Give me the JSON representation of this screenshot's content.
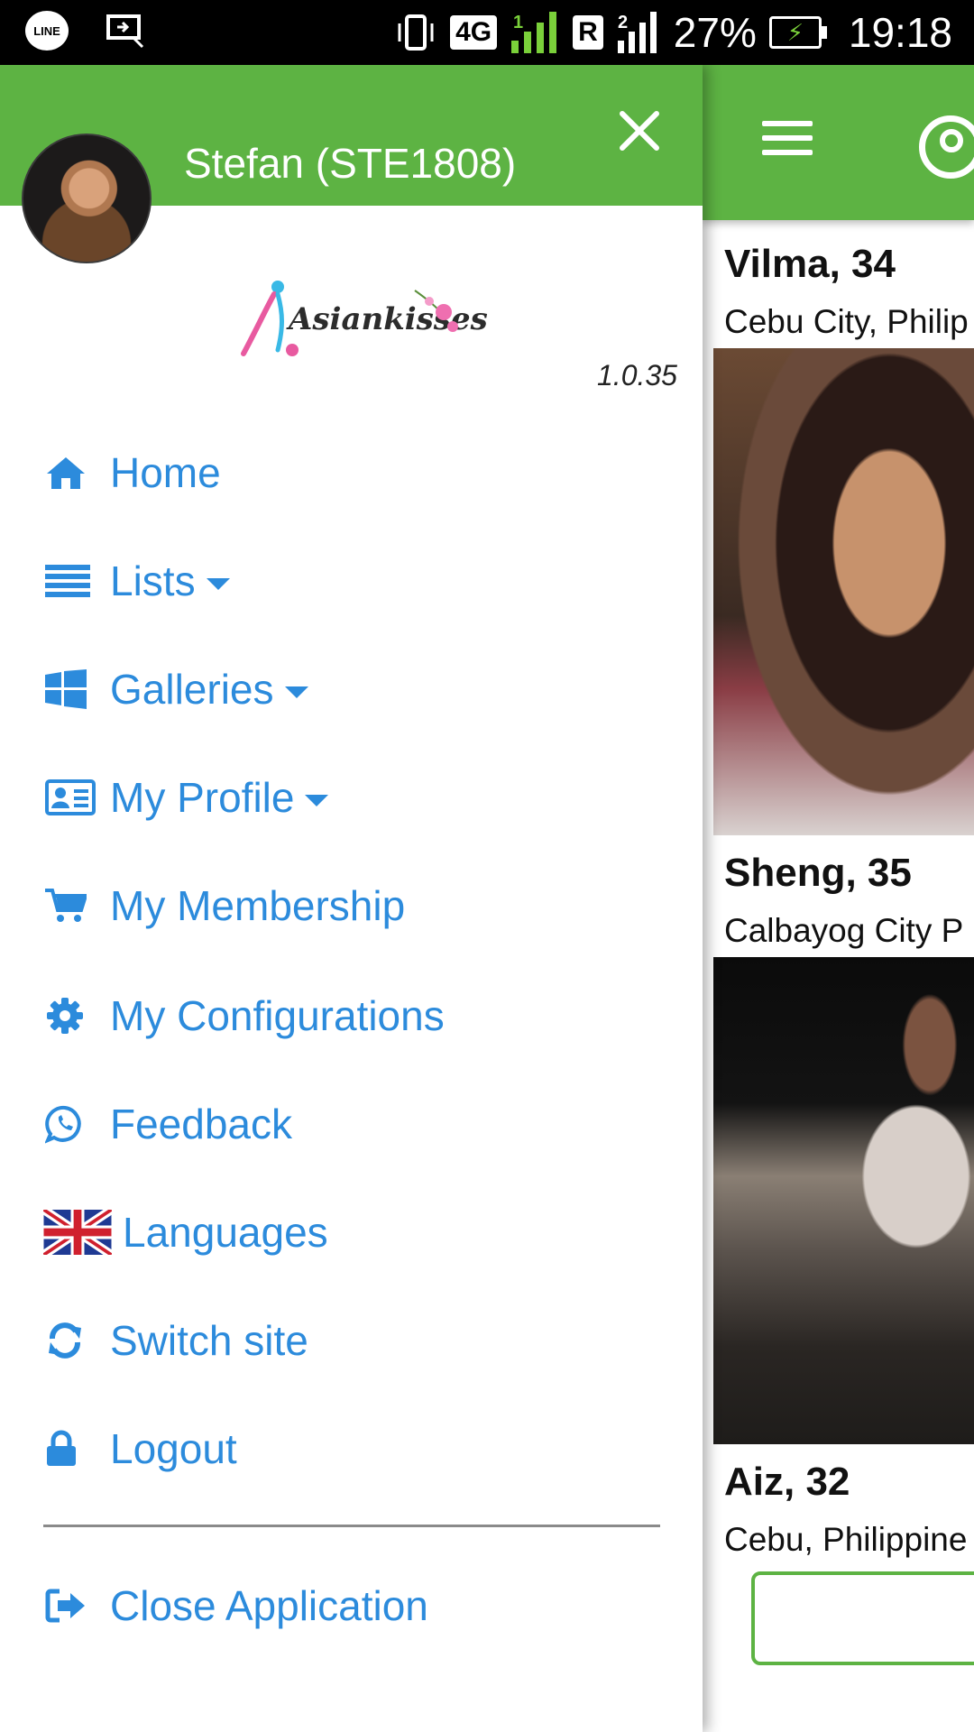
{
  "status_bar": {
    "line_label": "LINE",
    "network": "4G",
    "sim1": "1",
    "roaming": "R",
    "sim2": "2",
    "battery": "27%",
    "time": "19:18"
  },
  "drawer": {
    "user_name": "Stefan (STE1808)",
    "logo_text": "Asiankisses",
    "version": "1.0.35",
    "menu": [
      {
        "label": "Home",
        "icon": "home-icon"
      },
      {
        "label": "Lists",
        "icon": "list-icon",
        "dropdown": true
      },
      {
        "label": "Galleries",
        "icon": "windows-grid-icon",
        "dropdown": true
      },
      {
        "label": "My Profile",
        "icon": "id-card-icon",
        "dropdown": true
      },
      {
        "label": "My Membership",
        "icon": "cart-icon"
      },
      {
        "label": "My Configurations",
        "icon": "gear-icon"
      },
      {
        "label": "Feedback",
        "icon": "whatsapp-icon"
      },
      {
        "label": "Languages",
        "icon": "uk-flag-icon"
      },
      {
        "label": "Switch site",
        "icon": "refresh-icon"
      },
      {
        "label": "Logout",
        "icon": "lock-icon"
      }
    ],
    "close_app": {
      "label": "Close Application",
      "icon": "sign-out-icon"
    }
  },
  "background_list": {
    "profiles": [
      {
        "name": "Vilma, 34",
        "location": "Cebu City, Philip"
      },
      {
        "name": "Sheng, 35",
        "location": "Calbayog City P"
      },
      {
        "name": "Aiz, 32",
        "location": "Cebu, Philippine"
      }
    ]
  },
  "colors": {
    "header_green": "#5db343",
    "link_blue": "#2c8bdc"
  }
}
